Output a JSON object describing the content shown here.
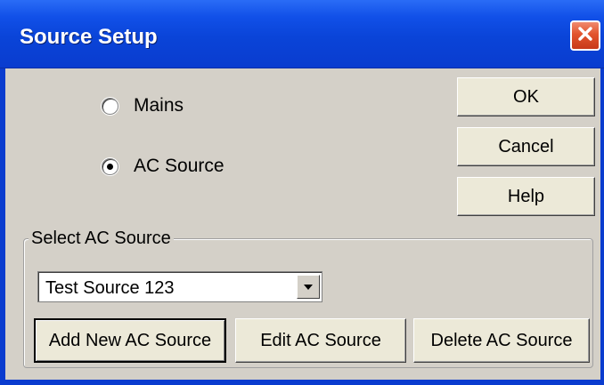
{
  "window": {
    "title": "Source Setup",
    "close_icon": "close-icon"
  },
  "power": {
    "options": [
      {
        "label": "Mains",
        "selected": false
      },
      {
        "label": "AC Source",
        "selected": true
      }
    ]
  },
  "actions": {
    "ok_label": "OK",
    "cancel_label": "Cancel",
    "help_label": "Help"
  },
  "ac_source": {
    "group_label": "Select AC Source",
    "selected": "Test Source 123",
    "add_label": "Add New AC Source",
    "edit_label": "Edit AC Source",
    "delete_label": "Delete AC Source"
  },
  "colors": {
    "titlebar": "#0a44d8",
    "dialog_bg": "#d4d0c8",
    "close_red": "#e2542d"
  }
}
